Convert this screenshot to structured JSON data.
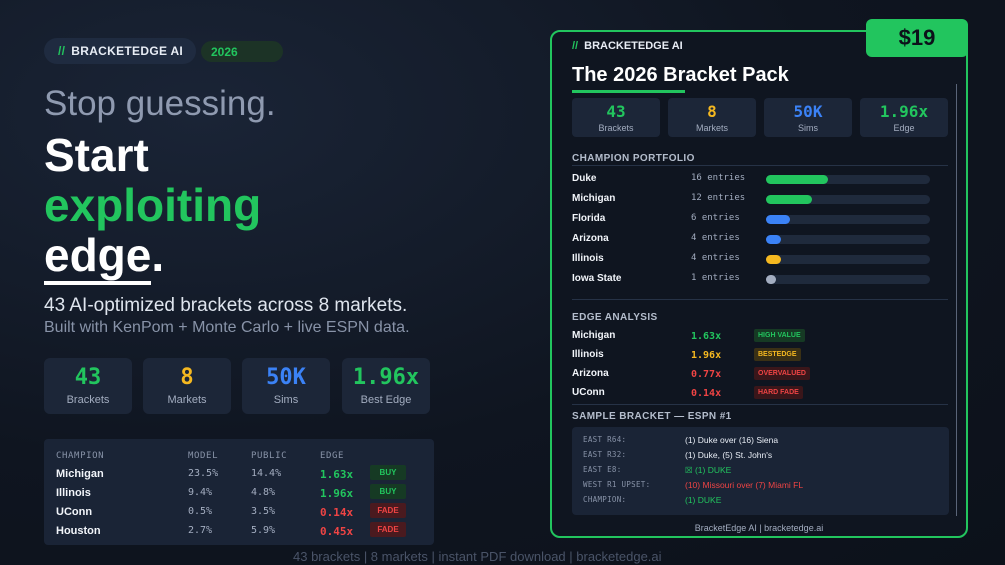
{
  "brand": {
    "slashes": "//",
    "name": "BRACKETEDGE AI",
    "year": "2026"
  },
  "hero": {
    "line1": "Stop guessing.",
    "line2": "Start",
    "line3": "exploiting",
    "line4_word": "edge",
    "line4_dot": "."
  },
  "subtitle": {
    "line1": "43 AI-optimized brackets across 8 markets.",
    "line2": "Built with KenPom + Monte Carlo + live ESPN data."
  },
  "stats": [
    {
      "value": "43",
      "label": "Brackets",
      "color": "#22c55e"
    },
    {
      "value": "8",
      "label": "Markets",
      "color": "#f5b820"
    },
    {
      "value": "50K",
      "label": "Sims",
      "color": "#3b82f6"
    },
    {
      "value": "1.96x",
      "label": "Best Edge",
      "color": "#22c55e"
    }
  ],
  "edge_table": {
    "headers": {
      "champion": "CHAMPION",
      "model": "MODEL",
      "public": "PUBLIC",
      "edge": "EDGE"
    },
    "rows": [
      {
        "team": "Michigan",
        "model": "23.5%",
        "public": "14.4%",
        "edge": "1.63x",
        "tag": "BUY",
        "kind": "buy"
      },
      {
        "team": "Illinois",
        "model": "9.4%",
        "public": "4.8%",
        "edge": "1.96x",
        "tag": "BUY",
        "kind": "buy"
      },
      {
        "team": "UConn",
        "model": "0.5%",
        "public": "3.5%",
        "edge": "0.14x",
        "tag": "FADE",
        "kind": "fade"
      },
      {
        "team": "Houston",
        "model": "2.7%",
        "public": "5.9%",
        "edge": "0.45x",
        "tag": "FADE",
        "kind": "fade"
      }
    ]
  },
  "footer": "43 brackets  |  8 markets  |  instant PDF download  |  bracketedge.ai",
  "card": {
    "price": "$19",
    "brand": "BRACKETEDGE AI",
    "title": "The 2026 Bracket Pack",
    "stats": [
      {
        "value": "43",
        "label": "Brackets",
        "color": "#22c55e"
      },
      {
        "value": "8",
        "label": "Markets",
        "color": "#f5b820"
      },
      {
        "value": "50K",
        "label": "Sims",
        "color": "#3b82f6"
      },
      {
        "value": "1.96x",
        "label": "Edge",
        "color": "#22c55e"
      }
    ],
    "portfolio_heading": "CHAMPION PORTFOLIO",
    "portfolio": [
      {
        "team": "Duke",
        "entries": "16 entries",
        "share": 0.375,
        "color": "#22c55e"
      },
      {
        "team": "Michigan",
        "entries": "12 entries",
        "share": 0.28,
        "color": "#22c55e"
      },
      {
        "team": "Florida",
        "entries": "6 entries",
        "share": 0.145,
        "color": "#3b82f6"
      },
      {
        "team": "Arizona",
        "entries": "4 entries",
        "share": 0.09,
        "color": "#3b82f6"
      },
      {
        "team": "Illinois",
        "entries": "4 entries",
        "share": 0.09,
        "color": "#f5b820"
      },
      {
        "team": "Iowa State",
        "entries": "1 entries",
        "share": 0.06,
        "color": "#a3adc0"
      }
    ],
    "edge_heading": "EDGE ANALYSIS",
    "edge_rows": [
      {
        "team": "Michigan",
        "value": "1.63x",
        "color": "#22c55e",
        "tag": "HIGH VALUE",
        "tagclass": "t-green"
      },
      {
        "team": "Illinois",
        "value": "1.96x",
        "color": "#f5b820",
        "tag": "BESTEDGE",
        "tagclass": "t-yellow"
      },
      {
        "team": "Arizona",
        "value": "0.77x",
        "color": "#ef4444",
        "tag": "OVERVALUED",
        "tagclass": "t-red"
      },
      {
        "team": "UConn",
        "value": "0.14x",
        "color": "#ef4444",
        "tag": "HARD FADE",
        "tagclass": "t-red"
      }
    ],
    "sample_heading": "SAMPLE BRACKET — ESPN #1",
    "sample_rows": [
      {
        "key": "EAST R64:",
        "value": "(1) Duke over (16) Siena",
        "color": "#e8edf5"
      },
      {
        "key": "EAST R32:",
        "value": "(1) Duke, (5) St. John's",
        "color": "#e8edf5"
      },
      {
        "key": "EAST E8:",
        "value": "☒ (1) DUKE",
        "color": "#22c55e"
      },
      {
        "key": "WEST R1 UPSET:",
        "value": "(10) Missouri over (7) Miami FL",
        "color": "#ef4444"
      },
      {
        "key": "CHAMPION:",
        "value": "(1) DUKE",
        "color": "#22c55e"
      }
    ],
    "footer": "BracketEdge AI  |  bracketedge.ai"
  }
}
